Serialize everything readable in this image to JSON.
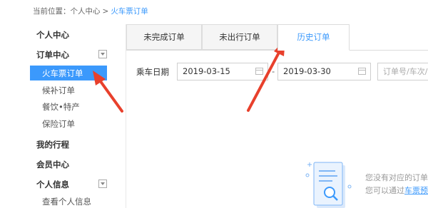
{
  "breadcrumb": {
    "prefix": "当前位置：",
    "home": "个人中心",
    "separator": ">",
    "current": "火车票订单"
  },
  "sidebar": {
    "personal_center": "个人中心",
    "order_center": "订单中心",
    "orders": {
      "train_ticket": "火车票订单",
      "waitlist": "候补订单",
      "catering": "餐饮•特产",
      "insurance": "保险订单"
    },
    "my_trips": "我的行程",
    "member_center": "会员中心",
    "personal_info": "个人信息",
    "view_personal_info": "查看个人信息"
  },
  "tabs": [
    {
      "label": "未完成订单"
    },
    {
      "label": "未出行订单"
    },
    {
      "label": "历史订单",
      "active": true
    }
  ],
  "filter": {
    "label": "乘车日期",
    "start_date": "2019-03-15",
    "dash": "-",
    "end_date": "2019-03-30",
    "search_placeholder": "订单号/车次/"
  },
  "empty_state": {
    "line1": "您没有对应的订单",
    "line2_prefix": "您可以通过",
    "line2_link": "车票预"
  },
  "colors": {
    "accent": "#3b99fc",
    "arrow": "#e8402c"
  }
}
